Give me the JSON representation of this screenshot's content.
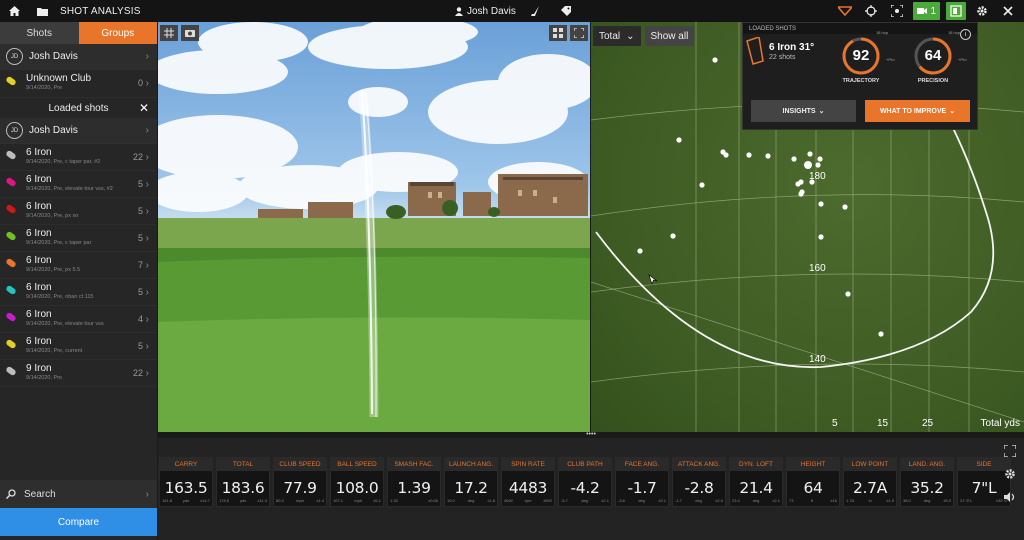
{
  "topbar": {
    "title": "SHOT ANALYSIS",
    "user": "Josh Davis",
    "green_count": "1",
    "icons": [
      "home-icon",
      "folder-icon",
      "user-icon",
      "club-icon",
      "tag-icon",
      "trackman-logo-icon",
      "target-icon",
      "screen-icon",
      "camera-icon",
      "device-icon",
      "gear-icon",
      "close-icon"
    ]
  },
  "sidebar": {
    "tab_shots": "Shots",
    "tab_groups": "Groups",
    "user_initials": "JD",
    "user_name": "Josh Davis",
    "unknown_club": {
      "name": "Unknown Club",
      "date": "9/14/2020, Pre",
      "count": "0"
    },
    "loaded_header": "Loaded shots",
    "loaded_user_initials": "JD",
    "loaded_user_name": "Josh Davis",
    "clubs": [
      {
        "name": "6 Iron",
        "desc": "9/14/2020, Pre, c taper par, #2",
        "count": "22",
        "color": "#bdbdbd"
      },
      {
        "name": "6 Iron",
        "desc": "9/14/2020, Pre, elevate tour vss, #2",
        "count": "5",
        "color": "#e0157f"
      },
      {
        "name": "6 Iron",
        "desc": "9/14/2020, Pre, px xo",
        "count": "5",
        "color": "#d01818"
      },
      {
        "name": "6 Iron",
        "desc": "9/14/2020, Pre, c taper par",
        "count": "5",
        "color": "#6fc221"
      },
      {
        "name": "6 Iron",
        "desc": "9/14/2020, Pre, px 5.5",
        "count": "7",
        "color": "#e8752a"
      },
      {
        "name": "6 Iron",
        "desc": "9/14/2020, Pre, oban ct 115",
        "count": "5",
        "color": "#1fc6c2"
      },
      {
        "name": "6 Iron",
        "desc": "9/14/2020, Pre, elevate tour vss",
        "count": "4",
        "color": "#c61ec9"
      },
      {
        "name": "6 Iron",
        "desc": "9/14/2020, Pre, current",
        "count": "5",
        "color": "#e4d021"
      },
      {
        "name": "9 Iron",
        "desc": "9/14/2020, Pre",
        "count": "22",
        "color": "#bdbdbd"
      }
    ],
    "search_label": "Search",
    "compare_label": "Compare"
  },
  "map": {
    "select_value": "Total",
    "show_all": "Show all",
    "dist_labels": [
      "180",
      "160",
      "140"
    ],
    "side_labels": [
      "5",
      "15",
      "25"
    ],
    "units_label": "Total yds"
  },
  "popup": {
    "header": "LOADED SHOTS",
    "club": "6 Iron 31°",
    "shots": "22 shots",
    "trajectory": {
      "value": "92",
      "label": "TRAJECTORY",
      "top": "18 hcp",
      "side": "+Pro",
      "fraction": 0.92
    },
    "precision": {
      "value": "64",
      "label": "PRECISION",
      "top": "18 hcp",
      "side": "+Pro",
      "fraction": 0.64
    },
    "insights": "INSIGHTS",
    "improve": "WHAT TO IMPROVE"
  },
  "stats": [
    {
      "label": "CARRY",
      "value": "163.5",
      "s1": "161.8",
      "s2": "yds",
      "s3": "±14.7"
    },
    {
      "label": "TOTAL",
      "value": "183.6",
      "s1": "179.5",
      "s2": "yds",
      "s3": "±11.3"
    },
    {
      "label": "CLUB SPEED",
      "value": "77.9",
      "s1": "80.3",
      "s2": "mph",
      "s3": "±1.4"
    },
    {
      "label": "BALL SPEED",
      "value": "108.0",
      "s1": "107.1",
      "s2": "mph",
      "s3": "±5.1"
    },
    {
      "label": "SMASH FAC.",
      "value": "1.39",
      "s1": "1.33",
      "s2": "",
      "s3": "±0.06"
    },
    {
      "label": "LAUNCH ANG.",
      "value": "17.2",
      "s1": "19.0",
      "s2": "deg",
      "s3": "±1.8"
    },
    {
      "label": "SPIN RATE",
      "value": "4483",
      "s1": "4692",
      "s2": "rpm",
      "s3": "±592"
    },
    {
      "label": "CLUB PATH",
      "value": "-4.2",
      "s1": "-5.7",
      "s2": "deg",
      "s3": "±2.1"
    },
    {
      "label": "FACE ANG.",
      "value": "-1.7",
      "s1": "-3.6",
      "s2": "deg",
      "s3": "±3.1"
    },
    {
      "label": "ATTACK ANG.",
      "value": "-2.8",
      "s1": "-1.7",
      "s2": "deg",
      "s3": "±2.0"
    },
    {
      "label": "DYN. LOFT",
      "value": "21.4",
      "s1": "23.4",
      "s2": "deg",
      "s3": "±2.1"
    },
    {
      "label": "HEIGHT",
      "value": "64",
      "s1": "73",
      "s2": "ft",
      "s3": "±16"
    },
    {
      "label": "LOW POINT",
      "value": "2.7A",
      "s1": "1.7A",
      "s2": "in",
      "s3": "±1.9"
    },
    {
      "label": "LAND. ANG.",
      "value": "35.2",
      "s1": "38.0",
      "s2": "deg",
      "s3": "±5.0"
    },
    {
      "label": "SIDE",
      "value": "7\"L",
      "s1": "21' 8\"L",
      "s2": "",
      "s3": "±35' 6\""
    }
  ]
}
